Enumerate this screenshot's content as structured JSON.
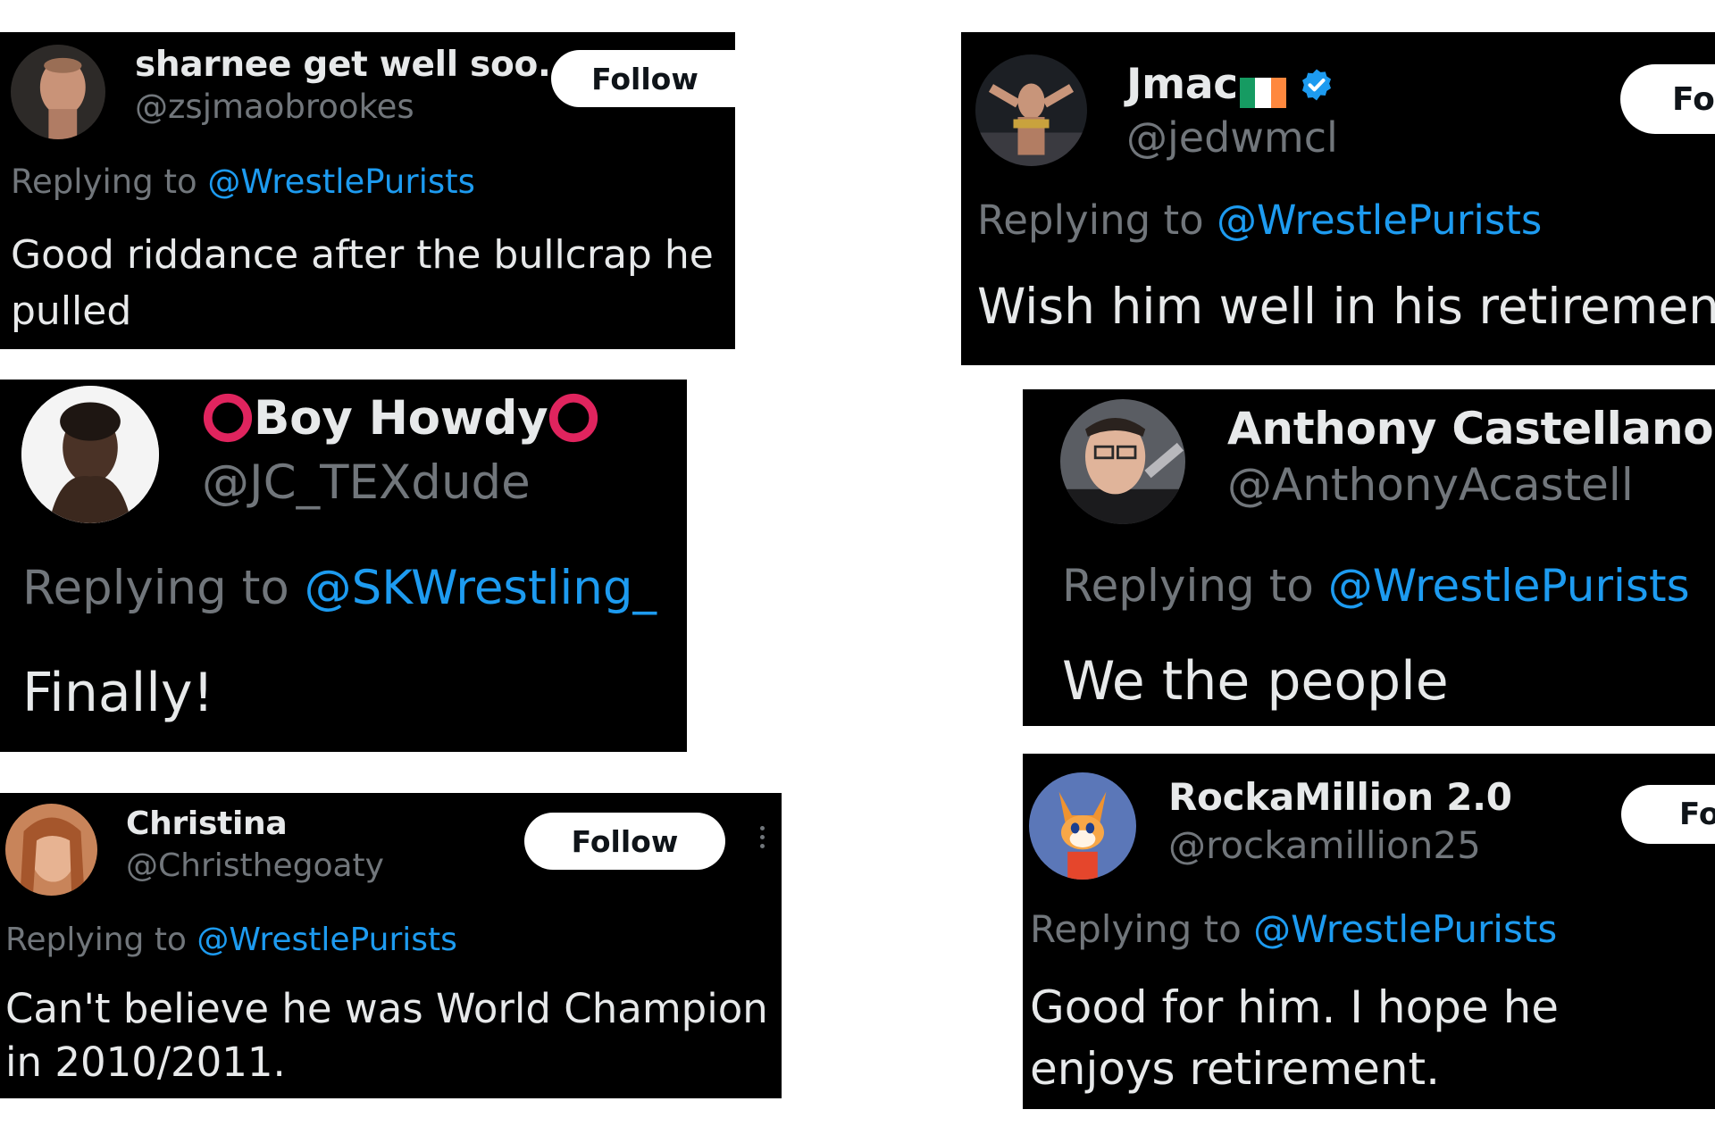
{
  "colors": {
    "background": "#ffffff",
    "card": "#000000",
    "name": "#e7e9ea",
    "muted": "#71767b",
    "mention": "#1d9bf0",
    "follow_button_bg": "#ffffff",
    "follow_button_text": "#0f1419",
    "verified": "#1d9bf0",
    "ring_emoji": "#e0245e"
  },
  "replying_prefix": "Replying to ",
  "tweets": [
    {
      "name": "sharnee get well soo...",
      "handle": "@zsjmaobrookes",
      "replying_to": "@WrestlePurists",
      "text": "Good riddance after the bullcrap he pulled",
      "follow_label": "Follow"
    },
    {
      "name": "Boy Howdy",
      "name_decoration": "red-ring-emoji",
      "handle": "@JC_TEXdude",
      "replying_to": "@SKWrestling_",
      "text": "Finally!"
    },
    {
      "name": "Christina",
      "handle": "@Christhegoaty",
      "replying_to": "@WrestlePurists",
      "text": "Can't believe he was World Champion in 2010/2011.",
      "follow_label": "Follow",
      "more_icon": "more-vertical-icon"
    },
    {
      "name": "Jmac",
      "name_decoration": "ireland-flag-emoji",
      "verified": true,
      "handle": "@jedwmcl",
      "replying_to": "@WrestlePurists",
      "text": "Wish him well in his retirement",
      "follow_label": "Fo"
    },
    {
      "name": "Anthony Castellano",
      "handle": "@AnthonyAcastell",
      "replying_to": "@WrestlePurists",
      "text": "We the people"
    },
    {
      "name": "RockaMillion 2.0",
      "handle": "@rockamillion25",
      "replying_to": "@WrestlePurists",
      "text": "Good for him. I hope he enjoys retirement.",
      "follow_label": "Fo"
    }
  ]
}
